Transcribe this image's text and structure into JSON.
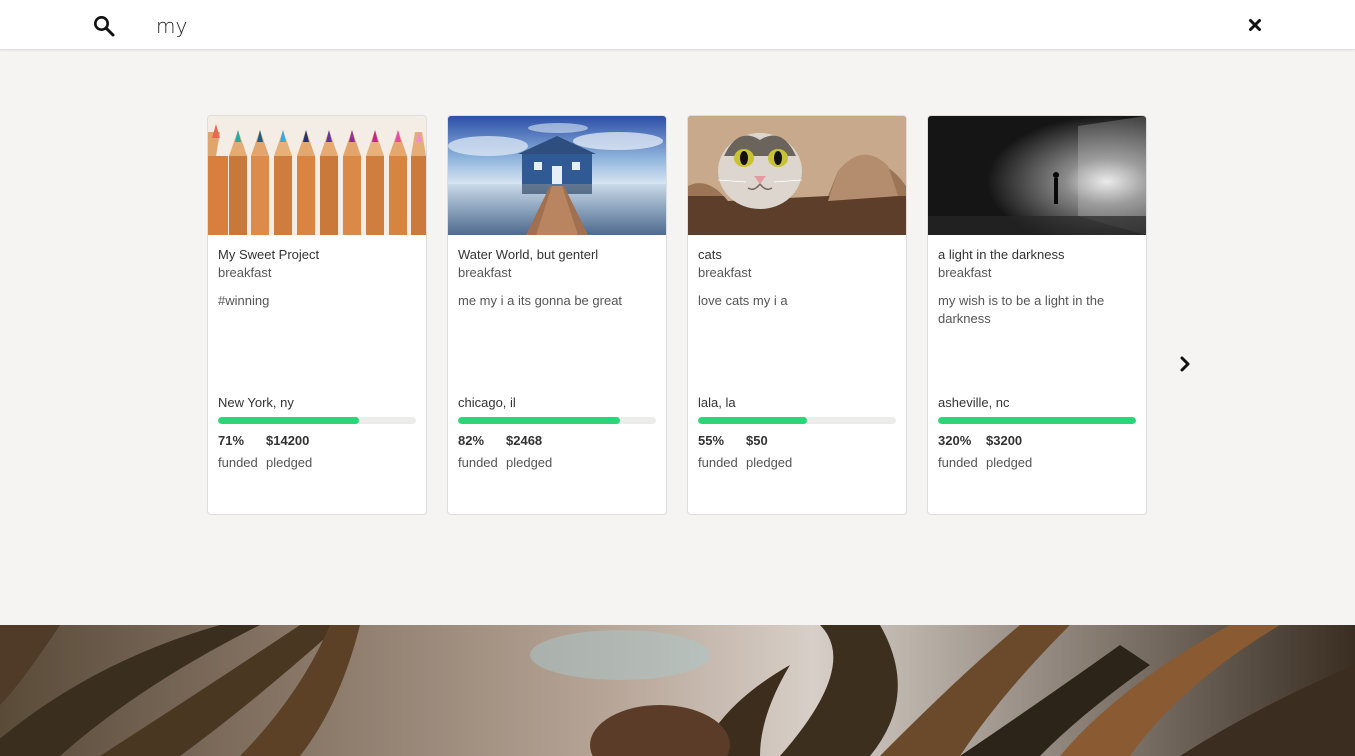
{
  "search": {
    "icon": "search-icon",
    "value": "my",
    "close_icon": "close-icon"
  },
  "cards": [
    {
      "title": "My Sweet Project",
      "category": "breakfast",
      "description": "#winning",
      "location": "New York, ny",
      "funded_percent": "71%",
      "funded_fraction": 0.71,
      "pledged": "$14200",
      "funded_label": "funded",
      "pledged_label": "pledged",
      "image": "colored-pencils-photo"
    },
    {
      "title": "Water World, but genterl",
      "category": "breakfast",
      "description": "me my i a its gonna be great",
      "location": "chicago, il",
      "funded_percent": "82%",
      "funded_fraction": 0.82,
      "pledged": "$2468",
      "funded_label": "funded",
      "pledged_label": "pledged",
      "image": "boathouse-pier-photo"
    },
    {
      "title": "cats",
      "category": "breakfast",
      "description": "love cats my i a",
      "location": "lala, la",
      "funded_percent": "55%",
      "funded_fraction": 0.55,
      "pledged": "$50",
      "funded_label": "funded",
      "pledged_label": "pledged",
      "image": "cat-in-paper-photo"
    },
    {
      "title": "a light in the darkness",
      "category": "breakfast",
      "description": "my wish is to be a light in the darkness",
      "location": "asheville, nc",
      "funded_percent": "320%",
      "funded_fraction": 1.0,
      "pledged": "$3200",
      "funded_label": "funded",
      "pledged_label": "pledged",
      "image": "rain-room-silhouette-photo"
    }
  ],
  "carousel": {
    "next_icon": "chevron-right-icon"
  },
  "colors": {
    "accent_green": "#2bd67b",
    "page_background": "#f5f4f2"
  }
}
